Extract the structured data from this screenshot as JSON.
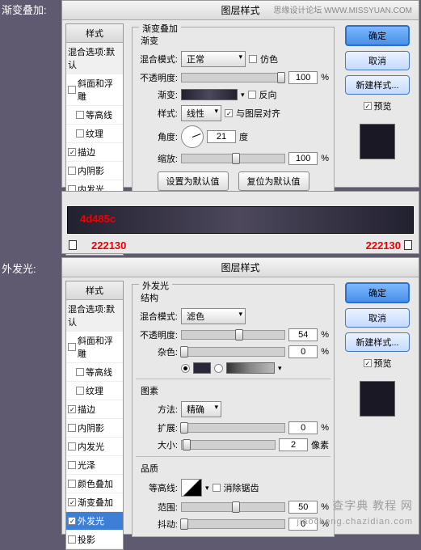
{
  "labels": {
    "gradOverlay": "渐变叠加:",
    "outerGlow": "外发光:"
  },
  "dialogTitle": "图层样式",
  "watermark1": "思缘设计论坛  WWW.MISSYUAN.COM",
  "watermark2": "查字典  教程 网",
  "watermark3": "jiaocheng.chazidian.com",
  "sidebar": {
    "header": "样式",
    "subheader": "混合选项:默认",
    "items": [
      "斜面和浮雕",
      "等高线",
      "纹理",
      "描边",
      "内阴影",
      "内发光",
      "光泽",
      "颜色叠加",
      "渐变叠加"
    ],
    "checked": [
      false,
      false,
      false,
      true,
      false,
      false,
      false,
      false,
      true
    ],
    "items2": [
      "斜面和浮雕",
      "等高线",
      "纹理",
      "描边",
      "内阴影",
      "内发光",
      "光泽",
      "颜色叠加",
      "渐变叠加",
      "外发光",
      "投影"
    ],
    "checked2": [
      false,
      false,
      false,
      true,
      false,
      false,
      false,
      false,
      true,
      true,
      false
    ]
  },
  "grad": {
    "groupTitle": "渐变叠加",
    "subTitle": "渐变",
    "blendMode": "混合模式:",
    "blendVal": "正常",
    "dither": "仿色",
    "opacity": "不透明度:",
    "opacityVal": "100",
    "pct": "%",
    "gradient": "渐变:",
    "reverse": "反向",
    "style": "样式:",
    "styleVal": "线性",
    "align": "与图层对齐",
    "angle": "角度:",
    "angleVal": "21",
    "deg": "度",
    "scale": "缩放:",
    "scaleVal": "100",
    "btnDefault": "设置为默认值",
    "btnReset": "复位为默认值"
  },
  "gradStrip": {
    "c1": "4d485c",
    "c2": "222130",
    "c3": "222130"
  },
  "glow": {
    "groupTitle": "外发光",
    "struct": "结构",
    "blendMode": "混合模式:",
    "blendVal": "滤色",
    "opacity": "不透明度:",
    "opacityVal": "54",
    "pct": "%",
    "noise": "杂色:",
    "noiseVal": "0",
    "elements": "图素",
    "method": "方法:",
    "methodVal": "精确",
    "spread": "扩展:",
    "spreadVal": "0",
    "size": "大小:",
    "sizeVal": "2",
    "px": "像素",
    "quality": "品质",
    "contour": "等高线:",
    "anti": "消除锯齿",
    "range": "范围:",
    "rangeVal": "50",
    "jitter": "抖动:",
    "jitterVal": "0"
  },
  "rightPanel": {
    "ok": "确定",
    "cancel": "取消",
    "newStyle": "新建样式...",
    "preview": "预览"
  }
}
